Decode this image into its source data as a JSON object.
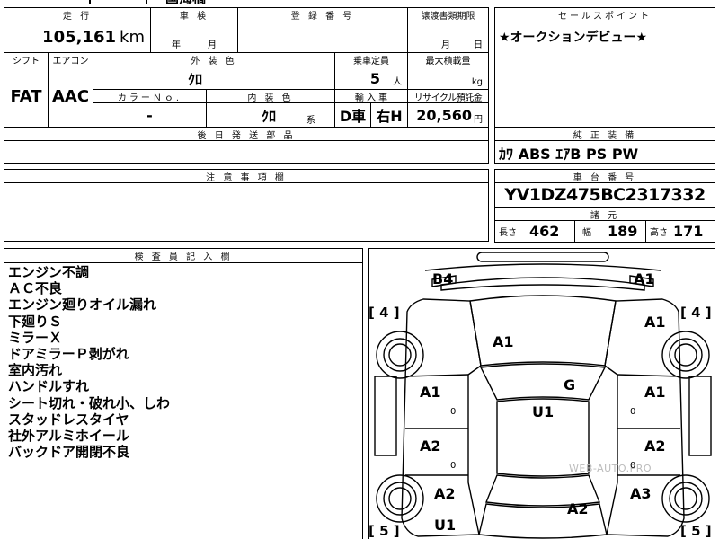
{
  "top_fragment": "国海橋",
  "header": {
    "mileage": "走 行",
    "inspection": "車 検",
    "registration": "登 録 番 号",
    "transfer_deadline": "譲渡書類期限",
    "sales_point": "セールスポイント"
  },
  "mileage": {
    "value": "105,161",
    "unit": "km"
  },
  "inspection_date": {
    "year": "年",
    "month": "月"
  },
  "transfer_date": {
    "month": "月",
    "day": "日"
  },
  "sales_point": "★オークションデビュー★",
  "row2": {
    "shift_label": "シフト",
    "ac_label": "エアコン",
    "exterior_label": "外 装 色",
    "capacity_label": "乗車定員",
    "max_load_label": "最大積載量",
    "shift": "FAT",
    "ac": "AAC",
    "exterior_color": "ｸﾛ",
    "capacity": "5",
    "capacity_unit": "人",
    "max_load_unit": "kg",
    "color_no_label": "カラーＮｏ.",
    "interior_label": "内 装 色",
    "import_label": "輸 入 車",
    "recycle_label": "リサイクル預託金",
    "color_no": "-",
    "interior_color": "ｸﾛ",
    "interior_suffix": "系",
    "import_d": "D車",
    "import_h": "右H",
    "recycle_value": "20,560",
    "recycle_unit": "円"
  },
  "later_parts_label": "後 日 発 送 部 品",
  "equipment": {
    "label": "純 正 装 備",
    "value": "ｶﾜ ABS ｴｱB PS PW"
  },
  "notes_label": "注 意 事 項 欄",
  "chassis": {
    "label": "車 台 番 号",
    "value": "YV1DZ475BC2317332"
  },
  "specs": {
    "label": "諸 元",
    "length_label": "長さ",
    "length": "462",
    "width_label": "幅",
    "width": "189",
    "height_label": "高さ",
    "height": "171"
  },
  "inspector": {
    "label": "検 査 員 記 入 欄",
    "items": [
      "エンジン不調",
      "ＡＣ不良",
      "エンジン廻りオイル漏れ",
      "下廻りＳ",
      "ミラーＸ",
      "ドアミラーＰ剥がれ",
      "室内汚れ",
      "ハンドルすれ",
      "シート切れ・破れ小、しわ",
      "スタッドレスタイヤ",
      "社外アルミホイール",
      "バックドア開閉不良"
    ]
  },
  "diagram": {
    "watermark": "WEB-AUTO.PRO",
    "labels": {
      "b4": "B4",
      "a1_front_right": "A1",
      "a1_hood": "A1",
      "a1_fender_right": "A1",
      "g_windshield": "G",
      "u1_roof": "U1",
      "a1_door_front_left": "A1",
      "a1_door_front_right": "A1",
      "a2_door_rear_left": "A2",
      "a2_door_rear_right": "A2",
      "a2_quarter_left": "A2",
      "a3_quarter_right": "A3",
      "a2_trunk": "A2",
      "u1_rear": "U1"
    },
    "zeros": [
      "0",
      "0",
      "0",
      "0"
    ],
    "tires": {
      "front_left": "[ 4 ]",
      "front_right": "[ 4 ]",
      "rear_left": "[ 5 ]",
      "rear_right": "[ 5 ]"
    }
  }
}
